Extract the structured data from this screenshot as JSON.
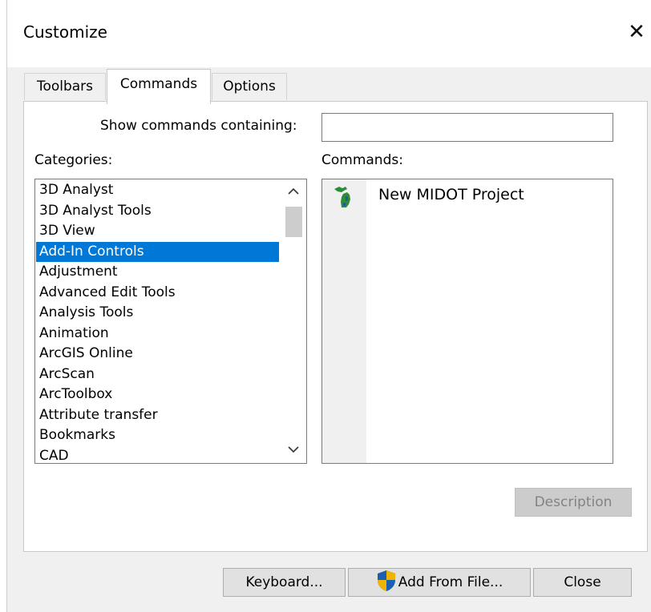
{
  "window": {
    "title": "Customize",
    "close_glyph": "✕"
  },
  "tabs": [
    {
      "label": "Toolbars",
      "active": false
    },
    {
      "label": "Commands",
      "active": true
    },
    {
      "label": "Options",
      "active": false
    }
  ],
  "filter": {
    "label": "Show commands containing:",
    "value": "",
    "placeholder": ""
  },
  "categories": {
    "label": "Categories:",
    "selected": "Add-In Controls",
    "items": [
      "3D Analyst",
      "3D Analyst Tools",
      "3D View",
      "Add-In Controls",
      "Adjustment",
      "Advanced Edit Tools",
      "Analysis Tools",
      "Animation",
      "ArcGIS Online",
      "ArcScan",
      "ArcToolbox",
      "Attribute transfer",
      "Bookmarks",
      "CAD"
    ],
    "scroll_up_glyph": "^",
    "scroll_down_glyph": "v"
  },
  "commands": {
    "label": "Commands:",
    "items": [
      {
        "label": "New MIDOT Project",
        "icon": "michigan-map-icon"
      }
    ]
  },
  "buttons": {
    "description": "Description",
    "keyboard": "Keyboard...",
    "add_from_file": "Add From File...",
    "close": "Close"
  },
  "colors": {
    "selection": "#0078d7",
    "shield_blue": "#1a5fb4",
    "shield_gold": "#f0b400",
    "icon_green": "#2e8b3a"
  }
}
